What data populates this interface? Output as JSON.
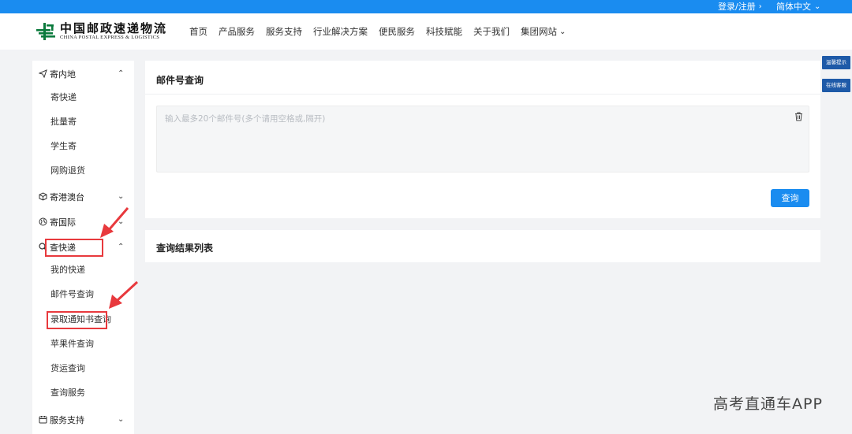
{
  "topbar": {
    "login_label": "登录/注册",
    "lang_label": "简体中文"
  },
  "logo": {
    "cn": "中国邮政速递物流",
    "en": "CHINA POSTAL EXPRESS & LOGISTICS",
    "brand_color": "#0a7a3c"
  },
  "nav": {
    "items": [
      "首页",
      "产品服务",
      "服务支持",
      "行业解决方案",
      "便民服务",
      "科技赋能",
      "关于我们",
      "集团网站"
    ]
  },
  "sidebar": {
    "group_send_domestic": "寄内地",
    "sub_send_express": "寄快递",
    "sub_bulk_send": "批量寄",
    "sub_student_send": "学生寄",
    "sub_online_return": "网购退货",
    "group_send_hkmo_tw": "寄港澳台",
    "group_send_international": "寄国际",
    "group_track": "查快递",
    "sub_my_express": "我的快递",
    "sub_mail_number_query": "邮件号查询",
    "sub_admission_notice_query": "录取通知书查询",
    "sub_apple_query": "苹果件查询",
    "sub_freight_query": "货运查询",
    "sub_query_service": "查询服务",
    "group_service_support": "服务支持"
  },
  "query_panel": {
    "title": "邮件号查询",
    "placeholder": "输入最多20个邮件号(多个请用空格或,隔开)",
    "button_label": "查询"
  },
  "results_panel": {
    "title": "查询结果列表"
  },
  "floating": {
    "tips_label": "温馨提示",
    "online_service_label": "在线客服"
  },
  "watermark": "高考直通车APP",
  "colors": {
    "accent": "#1a8cf0",
    "annotation_red": "#e8393d",
    "floating_bg": "#1e5aa8"
  }
}
